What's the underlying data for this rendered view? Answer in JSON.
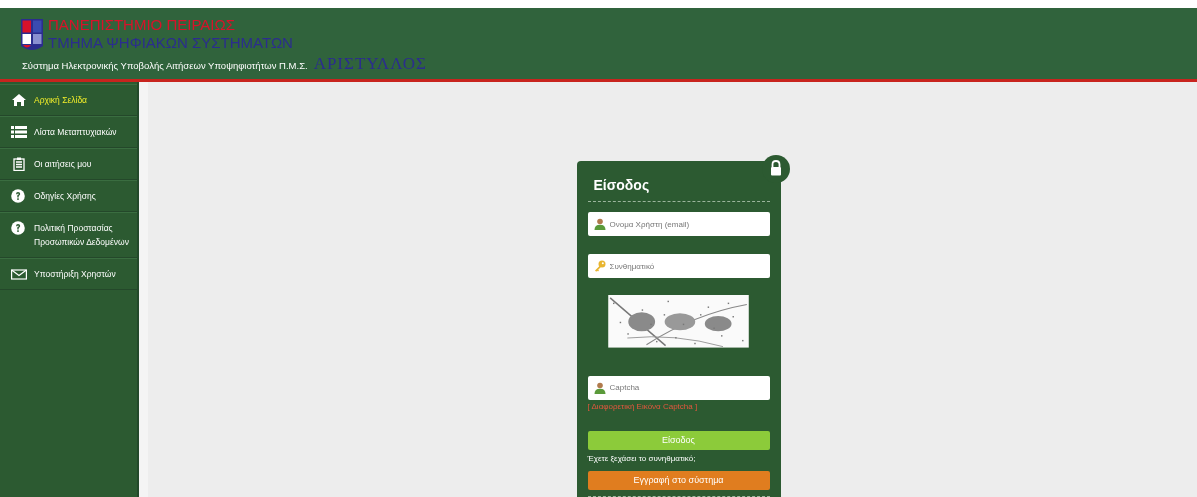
{
  "header": {
    "university": "ΠΑΝΕΠΙΣΤΗΜΙΟ ΠΕΙΡΑΙΩΣ",
    "department": "ΤΜΗΜΑ ΨΗΦΙΑΚΩΝ ΣΥΣΤΗΜΑΤΩΝ",
    "system": "Σύστημα Ηλεκτρονικής Υποβολής Αιτήσεων Υποψηφιοτήτων Π.Μ.Σ.",
    "brand": "ΑΡΙΣΤΥΛΛΟΣ"
  },
  "sidebar": {
    "items": [
      {
        "label": "Αρχική Σελίδα",
        "kind": "home",
        "selected": true
      },
      {
        "label": "Λίστα Μεταπτυχιακών",
        "kind": "list",
        "selected": false
      },
      {
        "label": "Οι αιτήσεις μου",
        "kind": "clipboard",
        "selected": false
      },
      {
        "label": "Οδηγίες Χρήσης",
        "kind": "help",
        "selected": false
      },
      {
        "label": "Πολιτική Προστασίας Προσωπικών Δεδομένων",
        "kind": "help",
        "selected": false
      },
      {
        "label": "Υποστήριξη Χρηστών",
        "kind": "mail",
        "selected": false
      }
    ]
  },
  "login": {
    "title": "Είσοδος",
    "fields": [
      {
        "placeholder": "Όνομα Χρήστη (email)",
        "kind": "user"
      },
      {
        "placeholder": "Συνθηματικό",
        "kind": "key"
      }
    ],
    "captcha_field": {
      "placeholder": "Captcha",
      "kind": "user"
    },
    "refresh_link": "[ Διαφορετική Εικόνα Captcha ]",
    "login_button": "Είσοδος",
    "forgot_link": "Έχετε ξεχάσει το συνηθματικό;",
    "register_button": "Εγγραφή στο σύστημα"
  }
}
